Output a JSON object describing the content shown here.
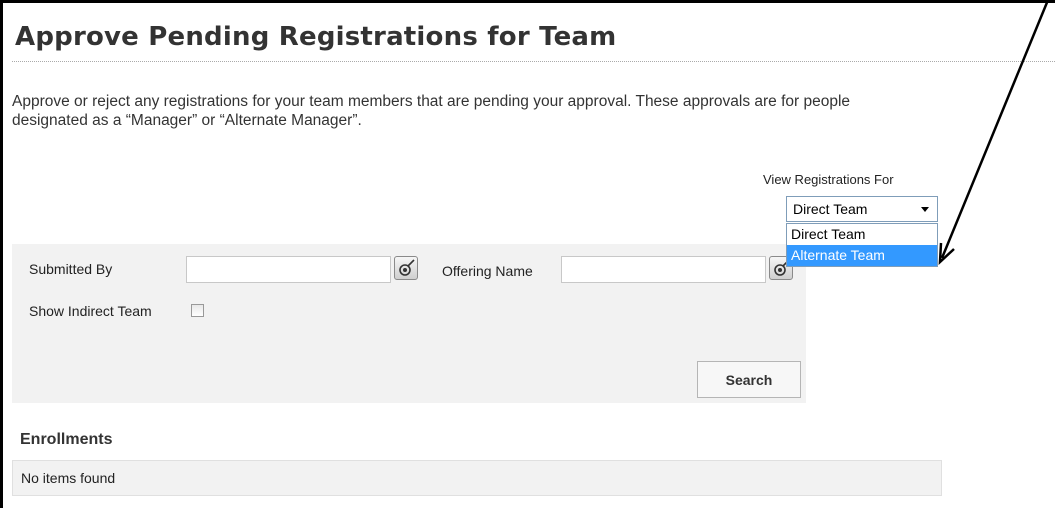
{
  "page": {
    "title": "Approve Pending Registrations for Team",
    "description_line1": "Approve or reject any registrations for your team members that are pending your approval. These approvals are for people",
    "description_line2": "designated as a “Manager” or “Alternate Manager”."
  },
  "view_registrations": {
    "label": "View Registrations For",
    "selected": "Direct Team",
    "options": [
      "Direct Team",
      "Alternate Team"
    ],
    "highlighted_option": "Alternate Team"
  },
  "filters": {
    "submitted_by_label": "Submitted By",
    "submitted_by_value": "",
    "offering_name_label": "Offering Name",
    "offering_name_value": "",
    "show_indirect_label": "Show Indirect Team",
    "show_indirect_checked": false,
    "search_label": "Search"
  },
  "enrollments": {
    "heading": "Enrollments",
    "empty_text": "No items found"
  },
  "icons": {
    "picker": "picker-icon",
    "chevron": "chevron-down-icon",
    "annotation": "annotation-arrow"
  },
  "colors": {
    "highlight": "#3399ff",
    "panel_bg": "#f2f2f2",
    "annotation_line": "#000000"
  }
}
